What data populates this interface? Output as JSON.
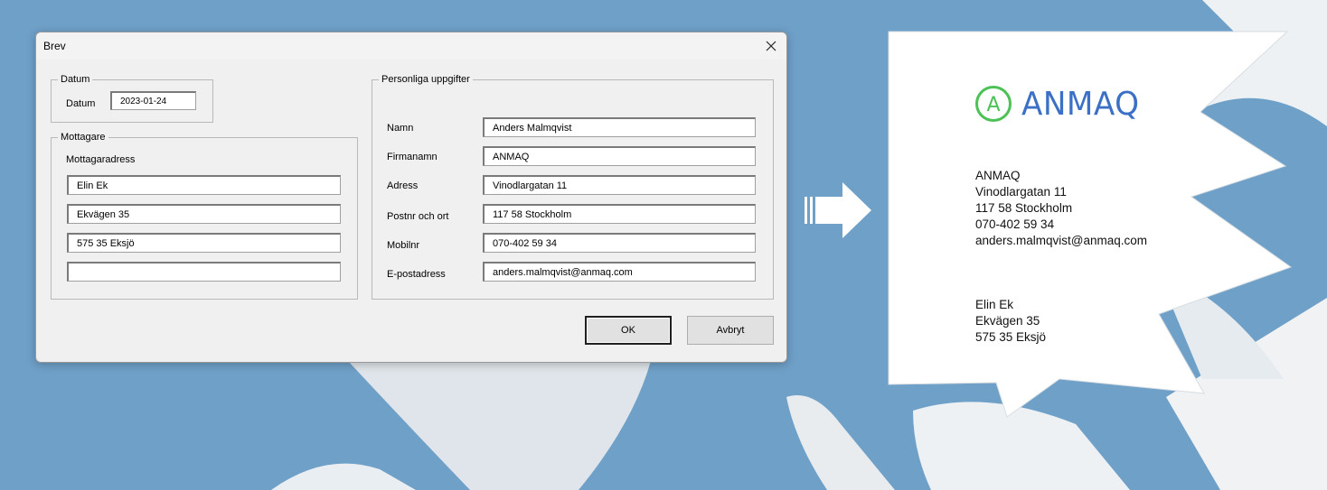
{
  "dialog": {
    "title": "Brev",
    "datum_group": {
      "legend": "Datum",
      "label": "Datum",
      "value": "2023-01-24"
    },
    "mottagare_group": {
      "legend": "Mottagare",
      "label": "Mottagaradress",
      "lines": [
        "Elin Ek",
        "Ekvägen 35",
        "575 35 Eksjö",
        ""
      ]
    },
    "personal_group": {
      "legend": "Personliga uppgifter",
      "fields": [
        {
          "label": "Namn",
          "value": "Anders Malmqvist"
        },
        {
          "label": "Firmanamn",
          "value": "ANMAQ"
        },
        {
          "label": "Adress",
          "value": "Vinodlargatan 11"
        },
        {
          "label": "Postnr och ort",
          "value": "117 58 Stockholm"
        },
        {
          "label": "Mobilnr",
          "value": "070-402 59 34"
        },
        {
          "label": "E-postadress",
          "value": "anders.malmqvist@anmaq.com"
        }
      ]
    },
    "ok_label": "OK",
    "cancel_label": "Avbryt"
  },
  "letter": {
    "logo_letter": "A",
    "logo_text": "ANMAQ",
    "sender_lines": [
      "ANMAQ",
      "Vinodlargatan 11",
      "117 58 Stockholm",
      "070-402 59 34",
      "anders.malmqvist@anmaq.com"
    ],
    "recipient_lines": [
      "Elin Ek",
      "Ekvägen 35",
      "575 35 Eksjö"
    ]
  },
  "colors": {
    "background": "#6fa0c8",
    "logo_green": "#4cc156",
    "logo_blue": "#3c6fc6"
  }
}
